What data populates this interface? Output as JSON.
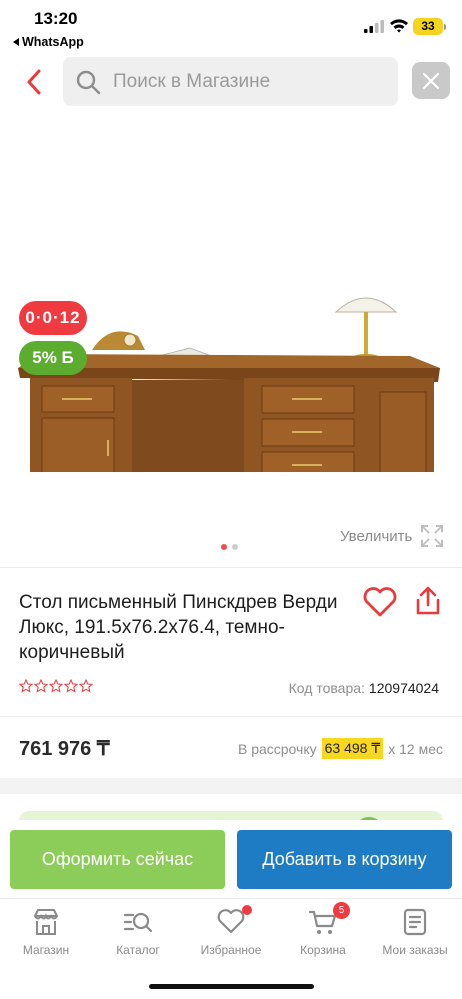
{
  "status_bar": {
    "time": "13:20",
    "back_app": "WhatsApp",
    "battery": "33"
  },
  "header": {
    "search_placeholder": "Поиск в Магазине",
    "back_icon": "chevron-left-icon",
    "clear_icon": "close-icon"
  },
  "gallery": {
    "badge_timer": "0·0·12",
    "badge_bonus": "5% Б",
    "zoom_label": "Увеличить",
    "slides_total": 2,
    "slide_active": 1
  },
  "product": {
    "title": "Стол письменный Пинскдрев Верди Люкс, 191.5x76.2x76.4, темно-коричневый",
    "rating_stars": 0,
    "code_label": "Код товара:",
    "code_value": "120974024",
    "price": "761 976 ₸",
    "installment_prefix": "В рассрочку",
    "installment_amount": "63 498 ₸",
    "installment_suffix": "x 12 мес"
  },
  "actions": {
    "order_now": "Оформить сейчас",
    "add_to_cart": "Добавить в корзину"
  },
  "tabbar": {
    "items": [
      {
        "label": "Магазин",
        "icon": "store-icon"
      },
      {
        "label": "Каталог",
        "icon": "catalog-search-icon"
      },
      {
        "label": "Избранное",
        "icon": "heart-icon"
      },
      {
        "label": "Корзина",
        "icon": "cart-icon",
        "badge": "5"
      },
      {
        "label": "Мои заказы",
        "icon": "orders-icon"
      }
    ]
  },
  "colors": {
    "accent_red": "#ef3b3f",
    "bonus_green": "#5cad2f",
    "order_green": "#8ccc58",
    "cart_blue": "#1e7cc4",
    "installment_yellow": "#f7d81e"
  }
}
